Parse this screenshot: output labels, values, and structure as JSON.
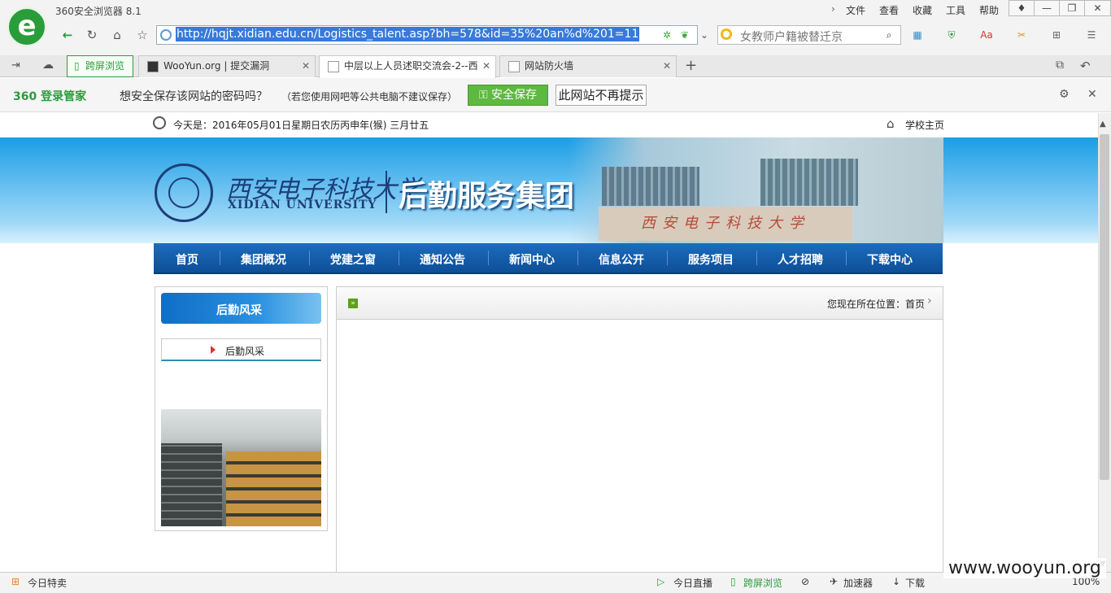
{
  "browser": {
    "title": "360安全浏览器 8.1",
    "menus": [
      "文件",
      "查看",
      "收藏",
      "工具",
      "帮助"
    ],
    "url": "http://hqjt.xidian.edu.cn/Logistics_talent.asp?bh=578&id=35%20an%d%201=11",
    "search_text": "女教师户籍被替迁京",
    "tabs": [
      {
        "label": "跨屏浏览"
      },
      {
        "label": "WooYun.org | 提交漏洞"
      },
      {
        "label": "中层以上人员述职交流会-2--西"
      },
      {
        "label": "网站防火墙"
      }
    ]
  },
  "password_bar": {
    "brand": "360 登录管家",
    "message": "想安全保存该网站的密码吗？",
    "note": "（若您使用网吧等公共电脑不建议保存）",
    "save_label": "安全保存",
    "never_label": "此网站不再提示"
  },
  "page": {
    "date_text": "今天是：2016年05月01日星期日农历丙申年(猴) 三月廿五",
    "home_link": "学校主页",
    "university_cn": "西安电子科技大学",
    "university_en": "XIDIAN UNIVERSITY",
    "group_name": "后勤服务集团",
    "stone_text": "西安电子科技大学",
    "nav": [
      "首页",
      "集团概况",
      "党建之窗",
      "通知公告",
      "新闻中心",
      "信息公开",
      "服务项目",
      "人才招聘",
      "下载中心"
    ],
    "sidebar_title": "后勤风采",
    "sidebar_item": "后勤风采",
    "location_label": "您现在所在位置：首页"
  },
  "status": {
    "left": "今日特卖",
    "live": "今日直播",
    "cross": "跨屏浏览",
    "accelerator": "加速器",
    "download": "下载",
    "zoom": "100%"
  },
  "watermark": "www.wooyun.org"
}
